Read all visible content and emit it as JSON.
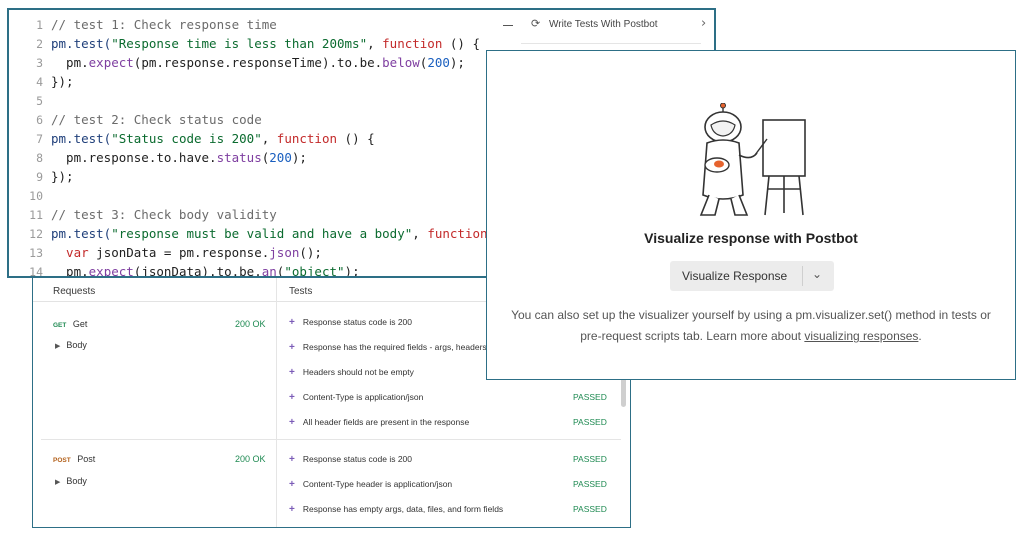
{
  "code": {
    "lines": [
      {
        "n": "1"
      },
      {
        "n": "2"
      },
      {
        "n": "3"
      },
      {
        "n": "4"
      },
      {
        "n": "5"
      },
      {
        "n": "6"
      },
      {
        "n": "7"
      },
      {
        "n": "8"
      },
      {
        "n": "9"
      },
      {
        "n": "10"
      },
      {
        "n": "11"
      },
      {
        "n": "12"
      },
      {
        "n": "13"
      },
      {
        "n": "14"
      }
    ],
    "t1_comment": "// test 1: Check response time",
    "t1_test": "pm.test(",
    "t1_name": "\"Response time is less than 200ms\"",
    "t1_fn": "function",
    "t1_end": " () {",
    "t1_body_a": "  pm.",
    "t1_body_expect": "expect",
    "t1_body_b": "(pm.response.responseTime).to.be.",
    "t1_body_below": "below",
    "t1_body_c": "(",
    "t1_body_num": "200",
    "t1_body_d": ");",
    "close": "});",
    "t2_comment": "// test 2: Check status code",
    "t2_test": "pm.test(",
    "t2_name": "\"Status code is 200\"",
    "t2_fn": "function",
    "t2_end": " () {",
    "t2_body_a": "  pm.response.to.have.",
    "t2_body_status": "status",
    "t2_body_b": "(",
    "t2_body_num": "200",
    "t2_body_c": ");",
    "t3_comment": "// test 3: Check body validity",
    "t3_test": "pm.test(",
    "t3_name": "\"response must be valid and have a body\"",
    "t3_fn": "function",
    "t3_end": " () {",
    "t3_var": "  var",
    "t3_var_rest": " jsonData = pm.response.",
    "t3_json": "json",
    "t3_var_end": "();",
    "t3_exp_a": "  pm.",
    "t3_exp_expect": "expect",
    "t3_exp_b": "(jsonData).to.be.",
    "t3_exp_an": "an",
    "t3_exp_c": "(",
    "t3_exp_str": "\"object\"",
    "t3_exp_d": ");"
  },
  "postbot_peek": {
    "label": "Write Tests With Postbot",
    "icon": "postbot-icon"
  },
  "results": {
    "col_requests": "Requests",
    "col_tests": "Tests",
    "requests": [
      {
        "method": "GET",
        "name": "Get",
        "status": "200 OK",
        "body_label": "Body",
        "tests": [
          {
            "name": "Response status code is 200",
            "result": ""
          },
          {
            "name": "Response has the required fields - args, headers, origin, and url",
            "result": ""
          },
          {
            "name": "Headers should not be empty",
            "result": ""
          },
          {
            "name": "Content-Type is application/json",
            "result": "PASSED"
          },
          {
            "name": "All header fields are present in the response",
            "result": "PASSED"
          }
        ]
      },
      {
        "method": "POST",
        "name": "Post",
        "status": "200 OK",
        "body_label": "Body",
        "tests": [
          {
            "name": "Response status code is 200",
            "result": "PASSED"
          },
          {
            "name": "Content-Type header is application/json",
            "result": "PASSED"
          },
          {
            "name": "Response has empty args, data, files, and form fields",
            "result": "PASSED"
          }
        ]
      }
    ]
  },
  "visualize": {
    "title": "Visualize response with Postbot",
    "button_label": "Visualize Response",
    "desc_pre": "You can also set up the visualizer yourself by using a pm.visualizer.set() method in tests or pre-request scripts tab. Learn more about ",
    "desc_link": "visualizing responses",
    "desc_post": "."
  },
  "colors": {
    "frame": "#2d6f86",
    "passed": "#1f8a52",
    "get": "#1f8a52",
    "post": "#b3601a",
    "plus": "#7b5bb7"
  }
}
